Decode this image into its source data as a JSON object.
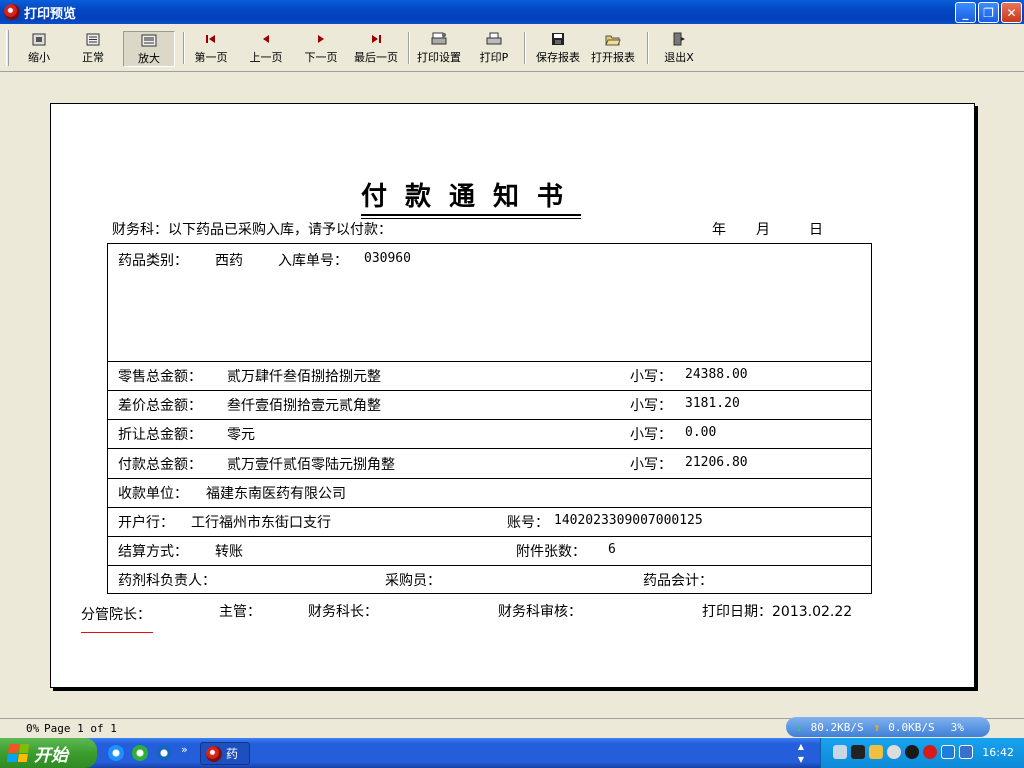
{
  "window": {
    "title": "打印预览",
    "minimize_glyph": "_",
    "maximize_glyph": "❐",
    "close_glyph": "✕"
  },
  "toolbar": {
    "zoom_out": "缩小",
    "normal": "正常",
    "zoom_in": "放大",
    "first_page": "第一页",
    "prev_page": "上一页",
    "next_page": "下一页",
    "last_page": "最后一页",
    "print_setup": "打印设置",
    "print": "打印P",
    "save_report": "保存报表",
    "open_report": "打开报表",
    "exit": "退出X"
  },
  "document": {
    "title": "付款通知书",
    "intro": "财务科：以下药品已采购入库，请予以付款：",
    "date_year": "年",
    "date_month": "月",
    "date_day": "日",
    "drug_category_label": "药品类别：",
    "drug_category_value": "西药",
    "receipt_no_label": "入库单号：",
    "receipt_no_value": "030960",
    "rows": [
      {
        "label": "零售总金额：",
        "upper": "贰万肆仟叁佰捌拾捌元整",
        "small_label": "小写：",
        "small_value": "24388.00"
      },
      {
        "label": "差价总金额：",
        "upper": "叁仟壹佰捌拾壹元贰角整",
        "small_label": "小写：",
        "small_value": "3181.20"
      },
      {
        "label": "折让总金额：",
        "upper": "零元",
        "small_label": "小写：",
        "small_value": "0.00"
      },
      {
        "label": "付款总金额：",
        "upper": "贰万壹仟贰佰零陆元捌角整",
        "small_label": "小写：",
        "small_value": "21206.80"
      }
    ],
    "payee_label": "收款单位：",
    "payee_value": "福建东南医药有限公司",
    "bank_label": "开户行：",
    "bank_value": "工行福州市东街口支行",
    "account_label": "账号：",
    "account_value": "1402023309007000125",
    "settlement_label": "结算方式：",
    "settlement_value": "转账",
    "attachments_label": "附件张数：",
    "attachments_value": "6",
    "pharmacy_head": "药剂科负责人：",
    "purchaser": "采购员：",
    "drug_accountant": "药品会计：",
    "vice_president": "分管院长：",
    "supervisor": "主管：",
    "finance_head": "财务科长：",
    "finance_auditor": "财务科审核：",
    "print_date": "打印日期：2013.02.22"
  },
  "status": {
    "zoom": "0%",
    "page_info": "Page 1 of 1",
    "download": "80.2KB/S",
    "upload": "0.0KB/S",
    "cpu": "3%"
  },
  "taskbar": {
    "start": "开始",
    "task_label": "药",
    "clock": "16:42",
    "more": "»"
  }
}
